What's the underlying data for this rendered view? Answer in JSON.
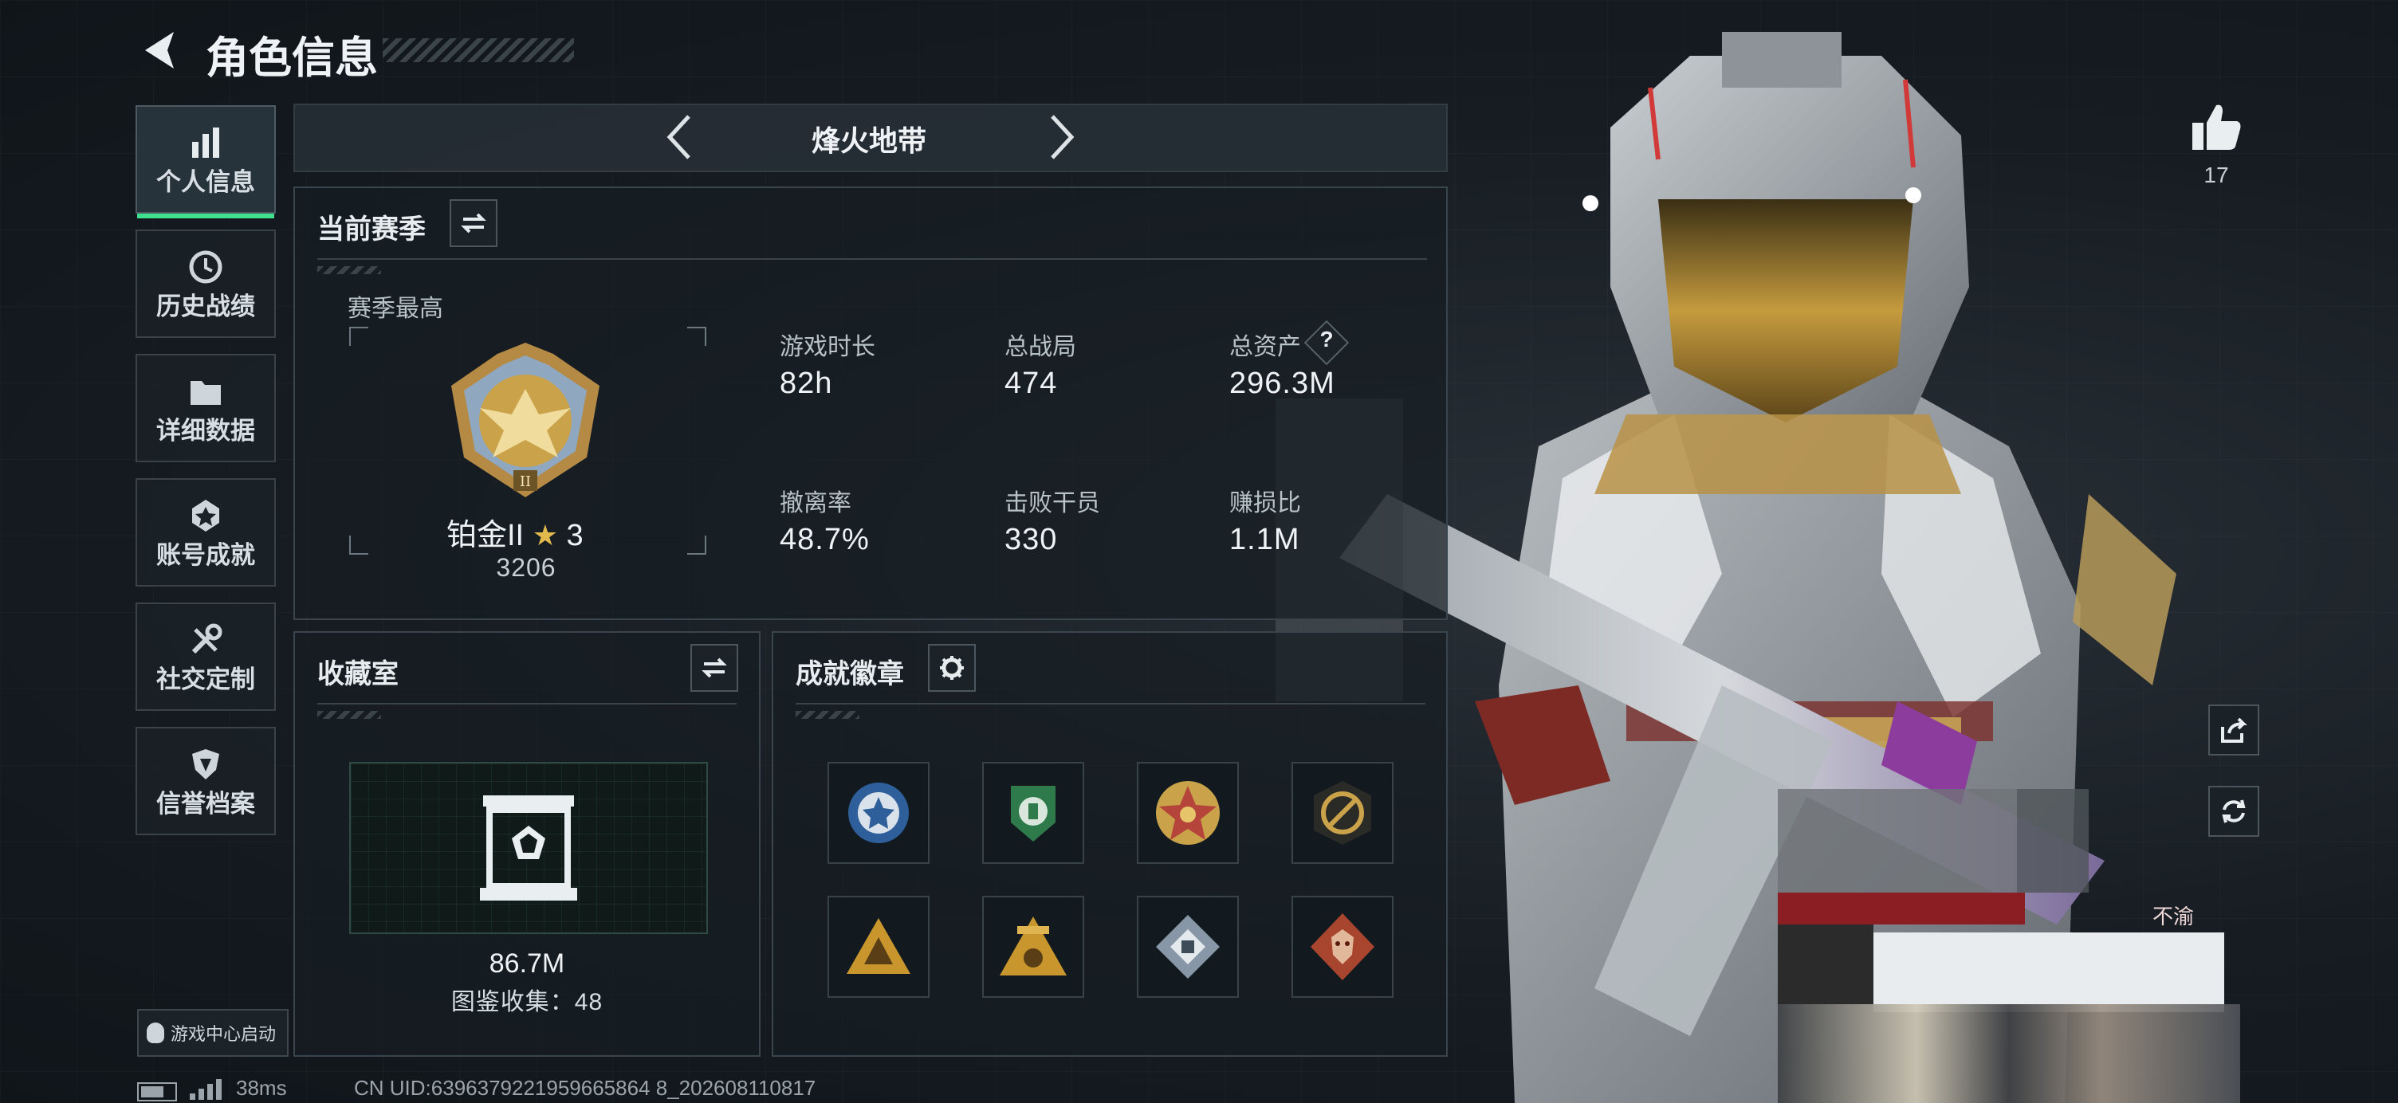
{
  "header": {
    "title": "角色信息"
  },
  "sidebar": {
    "items": [
      {
        "label": "个人信息",
        "icon": "bar-chart-icon",
        "active": true
      },
      {
        "label": "历史战绩",
        "icon": "clock-icon"
      },
      {
        "label": "详细数据",
        "icon": "folder-icon"
      },
      {
        "label": "账号成就",
        "icon": "medal-icon"
      },
      {
        "label": "社交定制",
        "icon": "wrench-icon"
      },
      {
        "label": "信誉档案",
        "icon": "shield-icon"
      }
    ],
    "launch_label": "游戏中心启动"
  },
  "mode_selector": {
    "label": "烽火地带"
  },
  "season": {
    "title": "当前赛季",
    "best_label": "赛季最高",
    "rank": "铂金II",
    "stars": "3",
    "score": "3206",
    "stats": [
      {
        "label": "游戏时长",
        "value": "82h"
      },
      {
        "label": "总战局",
        "value": "474"
      },
      {
        "label": "总资产",
        "value": "296.3M",
        "help": "?"
      },
      {
        "label": "撤离率",
        "value": "48.7%"
      },
      {
        "label": "击败干员",
        "value": "330"
      },
      {
        "label": "赚损比",
        "value": "1.1M"
      }
    ]
  },
  "collection": {
    "title": "收藏室",
    "value": "86.7M",
    "count_label": "图鉴收集：48"
  },
  "achievements": {
    "title": "成就徽章",
    "badges": [
      {
        "name": "badge-blue-star",
        "color": "#2f5f9a"
      },
      {
        "name": "badge-green-shield",
        "color": "#2f7a4a"
      },
      {
        "name": "badge-red-gold-star",
        "color": "#b5443a"
      },
      {
        "name": "badge-dark-gold-circle",
        "color": "#8a7440"
      },
      {
        "name": "badge-gold-triangle",
        "color": "#c9962e"
      },
      {
        "name": "badge-gold-triangle-crest",
        "color": "#c9962e"
      },
      {
        "name": "badge-silver-diamond",
        "color": "#8797a8"
      },
      {
        "name": "badge-red-dragon",
        "color": "#a8452f"
      }
    ]
  },
  "right_panel": {
    "like_count": "17",
    "overlay_text": "不渝"
  },
  "status_bar": {
    "ping": "38ms",
    "uid": "CN UID:6396379221959665864 8_202608110817"
  },
  "colors": {
    "accent": "#3fe08d",
    "panel_border": "#3a444c",
    "gold": "#c9a24a"
  }
}
